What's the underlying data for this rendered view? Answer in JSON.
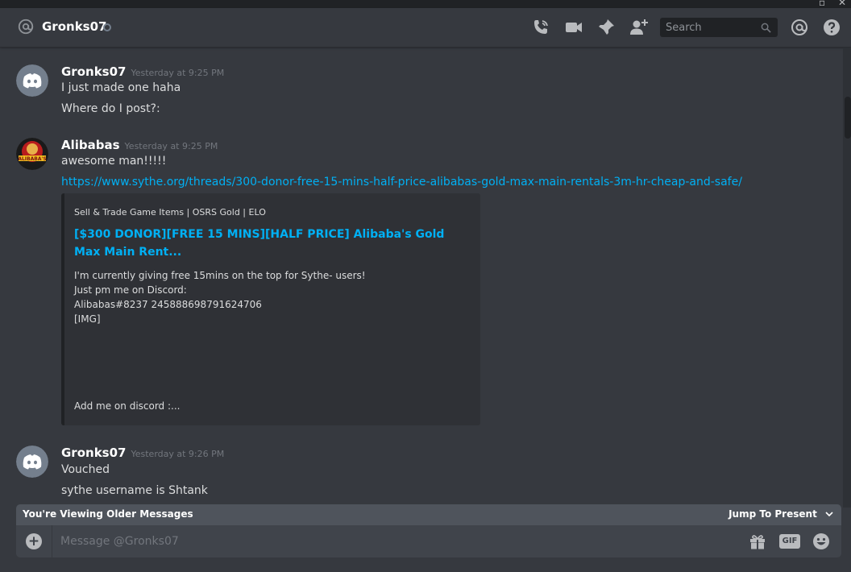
{
  "header": {
    "title": "Gronks07",
    "search_placeholder": "Search",
    "icons": [
      "call-icon",
      "video-icon",
      "pin-icon",
      "add-friend-icon",
      "mention-icon",
      "help-icon"
    ]
  },
  "messages": [
    {
      "user": "Gronks07",
      "timestamp": "Yesterday at 9:25 PM",
      "lines": [
        "I just made one haha",
        "Where do I post?:"
      ]
    },
    {
      "user": "Alibabas",
      "timestamp": "Yesterday at 9:25 PM",
      "lines": [
        "awesome man!!!!!"
      ],
      "link": "https://www.sythe.org/threads/300-donor-free-15-mins-half-price-alibabas-gold-max-main-rentals-3m-hr-cheap-and-safe/",
      "avatar_text": "ALIBABA'S",
      "embed": {
        "provider": "Sell & Trade Game Items | OSRS Gold | ELO",
        "title": "[$300 DONOR][FREE 15 MINS][HALF PRICE] Alibaba's Gold Max Main Rent...",
        "description": [
          "I'm currently giving free 15mins on the top for Sythe- users!",
          "Just pm me on Discord:",
          "Alibabas#8237 245888698791624706",
          "[IMG]"
        ],
        "footer": "Add me on discord :..."
      }
    },
    {
      "user": "Gronks07",
      "timestamp": "Yesterday at 9:26 PM",
      "lines": [
        "Vouched",
        "sythe username is Shtank"
      ]
    }
  ],
  "banner": {
    "left": "You're Viewing Older Messages",
    "right": "Jump To Present"
  },
  "composer": {
    "placeholder": "Message @Gronks07",
    "gif_label": "GIF"
  },
  "colors": {
    "background": "#36393f",
    "link": "#00b0f4",
    "blurple": "#7289da",
    "alibabas_avatar": "#b81d1d"
  }
}
